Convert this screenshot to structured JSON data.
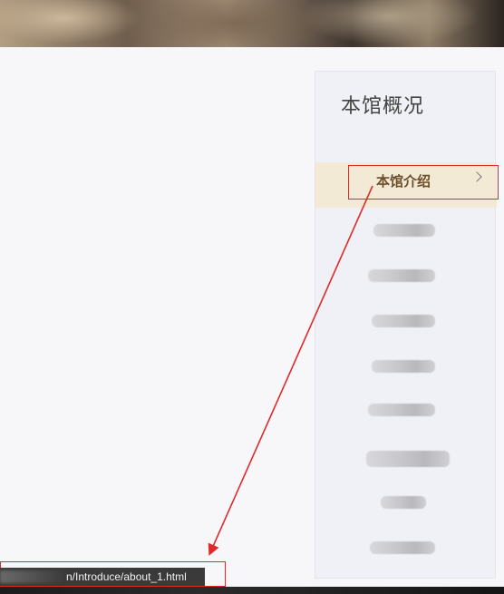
{
  "sidebar": {
    "title": "本馆概况",
    "active_item": {
      "label": "本馆介绍",
      "icon": "chevron-right-icon"
    },
    "blurred_items_count": 8
  },
  "status_bar": {
    "url_suffix": "n/Introduce/about_1.html"
  },
  "colors": {
    "highlight_red": "#e02a2a",
    "active_bg": "#f3ead6",
    "active_text": "#6b4e2a",
    "sidebar_bg": "#f0f1f6"
  }
}
